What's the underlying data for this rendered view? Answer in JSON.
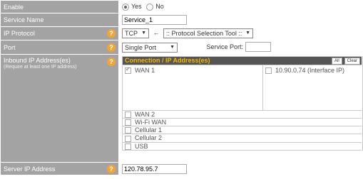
{
  "enable": {
    "label": "Enable",
    "yes": "Yes",
    "no": "No"
  },
  "service_name": {
    "label": "Service Name",
    "value": "Service_1"
  },
  "ip_protocol": {
    "label": "IP Protocol",
    "protocol": "TCP",
    "arrow": "←",
    "tool": ":: Protocol Selection Tool ::"
  },
  "port": {
    "label": "Port",
    "mode": "Single Port",
    "service_port_label": "Service Port:",
    "service_port_value": ""
  },
  "inbound": {
    "label": "Inbound IP Address(es)",
    "sub": "(Require at least one IP address)",
    "header": "Connection / IP Address(es)",
    "all": "All",
    "clear": "Clear",
    "wan1": "WAN 1",
    "wan1_ip": "10.90.0.74 (Interface IP)",
    "others": [
      "WAN 2",
      "Wi-Fi WAN",
      "Cellular 1",
      "Cellular 2",
      "USB"
    ]
  },
  "server_ip": {
    "label": "Server IP Address",
    "value": "120.78.95.7"
  },
  "help_glyph": "?"
}
